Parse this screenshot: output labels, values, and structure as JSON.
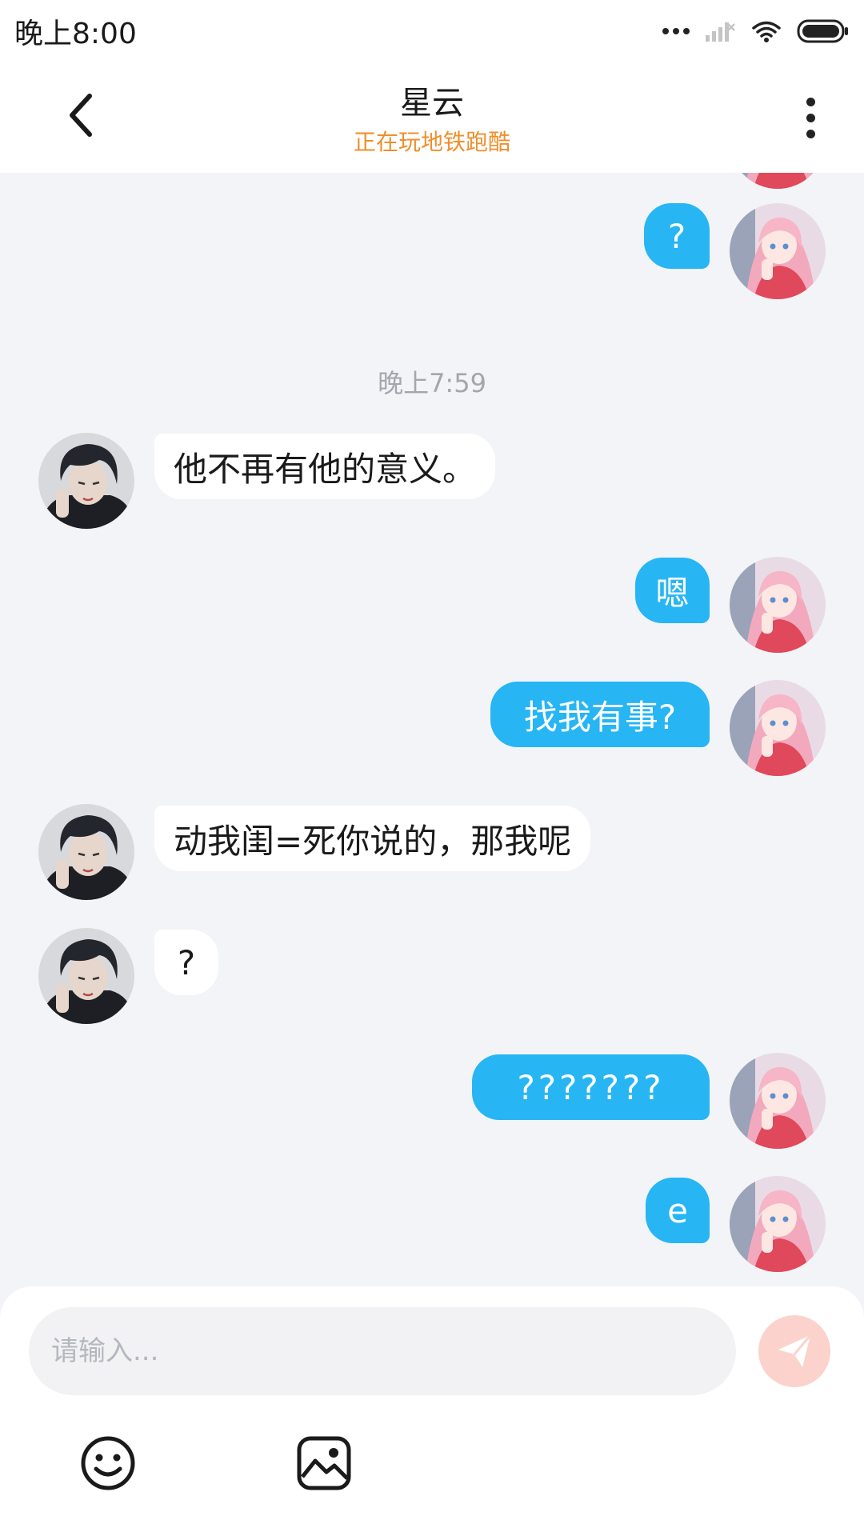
{
  "status_bar": {
    "time": "晚上8:00"
  },
  "header": {
    "title": "星云",
    "subtitle": "正在玩地铁跑酷"
  },
  "messages": [
    {
      "side": "me",
      "text": "?"
    },
    {
      "type": "timestamp",
      "text": "晚上7:59"
    },
    {
      "side": "them",
      "text": "他不再有他的意义。"
    },
    {
      "side": "me",
      "text": "嗯"
    },
    {
      "side": "me",
      "text": "找我有事?"
    },
    {
      "side": "them",
      "text": "动我闺=死你说的，那我呢"
    },
    {
      "side": "them",
      "text": "?"
    },
    {
      "side": "me",
      "text": "???????"
    },
    {
      "side": "me",
      "text": "e"
    }
  ],
  "input": {
    "placeholder": "请输入..."
  },
  "colors": {
    "my_bubble": "#27b5f4",
    "their_bubble": "#ffffff",
    "subtitle": "#ef8f2c",
    "send_button": "#fbd3cc",
    "background": "#f2f4f7"
  },
  "icons": {
    "back": "chevron-left-icon",
    "more": "more-vertical-icon",
    "send": "paper-plane-icon",
    "emoji": "smiley-icon",
    "image": "image-icon"
  }
}
